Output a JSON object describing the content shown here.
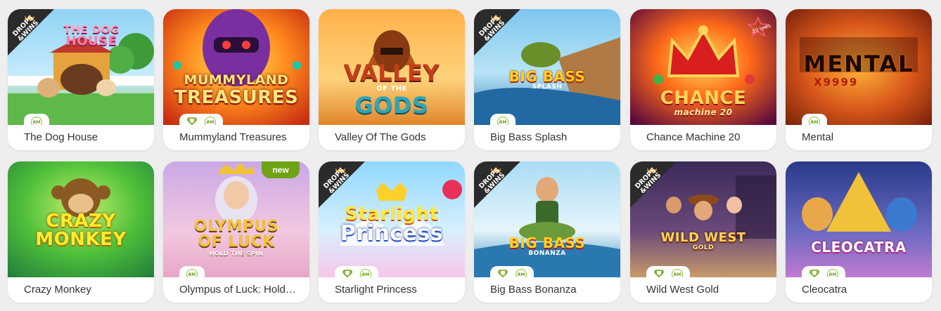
{
  "games": [
    {
      "title": "The Dog House",
      "logo_lines": [
        "THE DOG",
        "HOUSE"
      ],
      "drops_wins": true,
      "tournament": false,
      "rm": true,
      "new": false
    },
    {
      "title": "Mummyland Treasures",
      "logo_lines": [
        "MUMMYLAND",
        "TREASURES"
      ],
      "drops_wins": false,
      "tournament": true,
      "rm": true,
      "new": false
    },
    {
      "title": "Valley Of The Gods",
      "logo_lines": [
        "VALLEY",
        "OF THE",
        "GODS"
      ],
      "drops_wins": false,
      "tournament": false,
      "rm": false,
      "new": false
    },
    {
      "title": "Big Bass Splash",
      "logo_lines": [
        "BIG BASS",
        "SPLASH"
      ],
      "drops_wins": true,
      "tournament": false,
      "rm": true,
      "new": false
    },
    {
      "title": "Chance Machine 20",
      "logo_lines": [
        "CHANCE",
        "machine 20"
      ],
      "badge_text": "20 lines",
      "drops_wins": false,
      "tournament": false,
      "rm": false,
      "new": false
    },
    {
      "title": "Mental",
      "logo_lines": [
        "MENTAL",
        "X9999"
      ],
      "drops_wins": false,
      "tournament": false,
      "rm": true,
      "new": false
    },
    {
      "title": "Crazy Monkey",
      "logo_lines": [
        "CRAZY",
        "MONKEY"
      ],
      "drops_wins": false,
      "tournament": false,
      "rm": false,
      "new": false
    },
    {
      "title": "Olympus of Luck: Hold the Spin",
      "logo_lines": [
        "OLYMPUS",
        "OF LUCK",
        "HOLD THE SPIN"
      ],
      "drops_wins": false,
      "tournament": false,
      "rm": true,
      "new": true
    },
    {
      "title": "Starlight Princess",
      "logo_lines": [
        "Starlight",
        "Princess"
      ],
      "drops_wins": true,
      "tournament": true,
      "rm": true,
      "new": false
    },
    {
      "title": "Big Bass Bonanza",
      "logo_lines": [
        "BIG BASS",
        "BONANZA"
      ],
      "drops_wins": true,
      "tournament": true,
      "rm": true,
      "new": false
    },
    {
      "title": "Wild West Gold",
      "logo_lines": [
        "WILD WEST",
        "GOLD"
      ],
      "drops_wins": true,
      "tournament": true,
      "rm": true,
      "new": false
    },
    {
      "title": "Cleocatra",
      "logo_lines": [
        "CLEOCATRA"
      ],
      "drops_wins": false,
      "tournament": true,
      "rm": true,
      "new": false
    }
  ],
  "labels": {
    "drops_wins_line1": "DROPS",
    "drops_wins_line2": "&WINS",
    "rm_text": "RM",
    "new_text": "new"
  },
  "colors": {
    "accent_green": "#6fa317",
    "card_bg": "#ffffff",
    "page_bg": "#eeeeee",
    "title_text": "#333333"
  }
}
